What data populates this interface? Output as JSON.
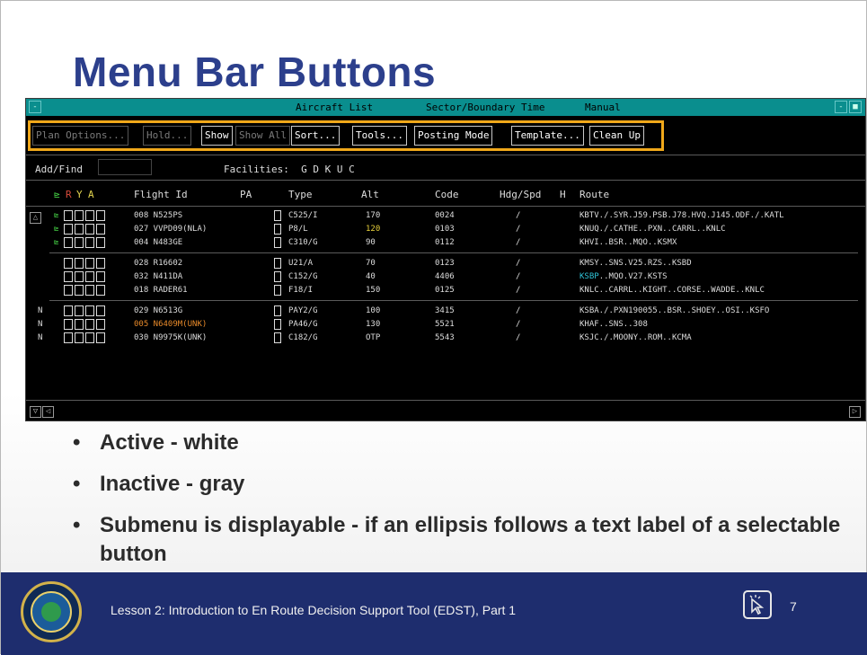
{
  "slide": {
    "title": "Menu Bar Buttons",
    "bullets": [
      "Active - white",
      "Inactive - gray",
      "Submenu is displayable - if an ellipsis follows a text label of a selectable button"
    ],
    "footer_text": "Lesson 2: Introduction to En Route Decision Support Tool (EDST), Part 1",
    "page_number": "7",
    "icons": {
      "seal": "faa-seal-logo",
      "cursor": "cursor-click-icon"
    }
  },
  "window": {
    "titlebar": {
      "items": [
        "Aircraft List",
        "Sector/Boundary Time",
        "Manual"
      ],
      "left_button": "-",
      "right_buttons": [
        "-",
        "■"
      ]
    },
    "menu": [
      {
        "label": "Plan Options...",
        "state": "inactive"
      },
      {
        "label": "Hold...",
        "state": "inactive"
      },
      {
        "label": "Show",
        "state": "active"
      },
      {
        "label": "Show All",
        "state": "inactive"
      },
      {
        "label": "Sort...",
        "state": "active"
      },
      {
        "label": "Tools...",
        "state": "active"
      },
      {
        "label": "Posting Mode",
        "state": "active"
      },
      {
        "label": "Template...",
        "state": "active"
      },
      {
        "label": "Clean Up",
        "state": "active"
      }
    ],
    "add_find_label": "Add/Find",
    "facilities_label": "Facilities:",
    "facilities_codes": "G D K U C",
    "header": {
      "indicators": {
        "g": "⊵",
        "r": "R",
        "y": "Y",
        "a": "A"
      },
      "flight_id": "Flight Id",
      "pa": "PA",
      "type": "Type",
      "alt": "Alt",
      "code": "Code",
      "hdg_spd": "Hdg/Spd",
      "h": "H",
      "route": "Route"
    },
    "rows": [
      {
        "prefix": "",
        "mark": "⊵",
        "flight": "008 N525PS",
        "type": "C525/I",
        "alt": "170",
        "code": "0024",
        "hdg": "/",
        "route": "KBTV./.SYR.J59.PSB.J78.HVQ.J145.ODF./.KATL",
        "flight_color": "",
        "alt_color": ""
      },
      {
        "prefix": "",
        "mark": "⊵",
        "flight": "027 VVPD09(NLA)",
        "type": "P8/L",
        "alt": "120",
        "code": "0103",
        "hdg": "/",
        "route": "KNUQ./.CATHE..PXN..CARRL..KNLC",
        "flight_color": "",
        "alt_color": "yellow"
      },
      {
        "prefix": "",
        "mark": "⊵",
        "flight": "004 N483GE",
        "type": "C310/G",
        "alt": "90",
        "code": "0112",
        "hdg": "/",
        "route": "KHVI..BSR..MQO..KSMX",
        "flight_color": "",
        "alt_color": ""
      },
      {
        "prefix": "",
        "mark": "",
        "flight": "028 R16602",
        "type": "U21/A",
        "alt": "70",
        "code": "0123",
        "hdg": "/",
        "route": "KMSY..SNS.V25.RZS..KSBD",
        "flight_color": "",
        "alt_color": ""
      },
      {
        "prefix": "",
        "mark": "",
        "flight": "032 N411DA",
        "type": "C152/G",
        "alt": "40",
        "code": "4406",
        "hdg": "/",
        "route_highlight": "KSBP",
        "route": "..MQO.V27.KSTS",
        "flight_color": "",
        "alt_color": ""
      },
      {
        "prefix": "",
        "mark": "",
        "flight": "018 RADER61",
        "type": "F18/I",
        "alt": "150",
        "code": "0125",
        "hdg": "/",
        "route": "KNLC..CARRL..KIGHT..CORSE..WADDE..KNLC",
        "flight_color": "",
        "alt_color": ""
      },
      {
        "prefix": "N",
        "mark": "",
        "flight": "029 N6513G",
        "type": "PAY2/G",
        "alt": "100",
        "code": "3415",
        "hdg": "/",
        "route": "KSBA./.PXN190055..BSR..SHOEY..OSI..KSFO",
        "flight_color": "",
        "alt_color": ""
      },
      {
        "prefix": "N",
        "mark": "",
        "flight": "005 N6409M(UNK)",
        "type": "PA46/G",
        "alt": "130",
        "code": "5521",
        "hdg": "/",
        "route": "KHAF..SNS..308",
        "flight_color": "orange",
        "alt_color": ""
      },
      {
        "prefix": "N",
        "mark": "",
        "flight": "030 N9975K(UNK)",
        "type": "C182/G",
        "alt": "OTP",
        "code": "5543",
        "hdg": "/",
        "route": "KSJC./.MOONY..ROM..KCMA",
        "flight_color": "",
        "alt_color": ""
      }
    ],
    "scroll": {
      "up": "△",
      "down": "▽",
      "left": "◁",
      "right": "▷"
    }
  }
}
